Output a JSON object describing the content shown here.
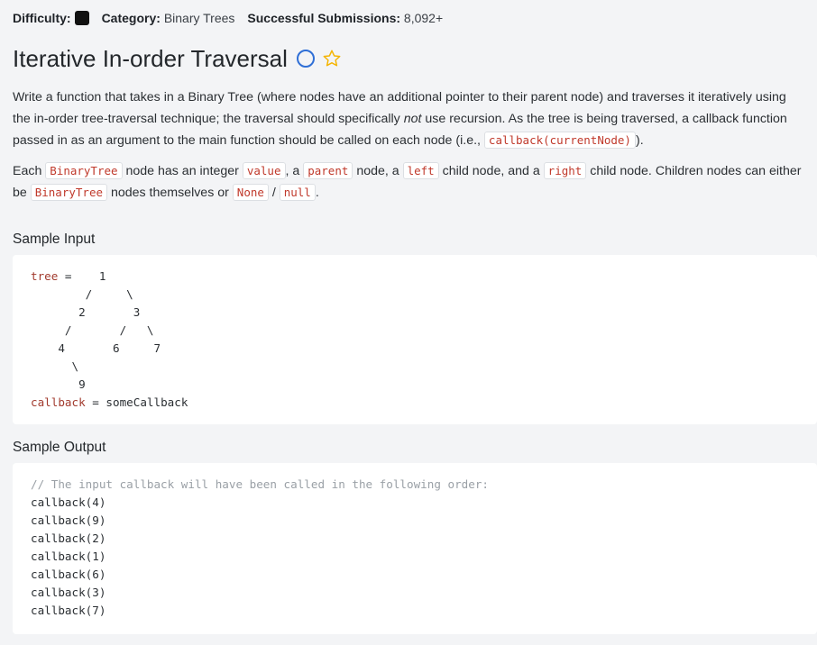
{
  "meta": {
    "difficulty_label": "Difficulty:",
    "category_label": "Category:",
    "category_value": "Binary Trees",
    "submissions_label": "Successful Submissions:",
    "submissions_value": "8,092+"
  },
  "title": "Iterative In-order Traversal",
  "description": {
    "p1_a": "Write a function that takes in a Binary Tree (where nodes have an additional pointer to their parent node) and traverses it iteratively using the in-order tree-traversal technique; the traversal should specifically ",
    "p1_em": "not",
    "p1_b": " use recursion. As the tree is being traversed, a callback function passed in as an argument to the main function should be called on each node (i.e., ",
    "p1_code": "callback(currentNode)",
    "p1_c": ").",
    "p2_each": "Each ",
    "p2_code1": "BinaryTree",
    "p2_t1": " node has an integer ",
    "p2_code2": "value",
    "p2_t2": ", a ",
    "p2_code3": "parent",
    "p2_t3": " node, a ",
    "p2_code4": "left",
    "p2_t4": " child node, and a ",
    "p2_code5": "right",
    "p2_t5": " child node. Children nodes can either be ",
    "p2_code6": "BinaryTree",
    "p2_t6": " nodes themselves or ",
    "p2_code7": "None",
    "p2_t7": " / ",
    "p2_code8": "null",
    "p2_t8": "."
  },
  "sample_input": {
    "label": "Sample Input",
    "tree_var": "tree",
    "tree_lines": [
      " =    1",
      "        /     \\",
      "       2       3",
      "     /       /   \\",
      "    4       6     7",
      "      \\",
      "       9"
    ],
    "callback_var": "callback",
    "callback_rest": " = someCallback"
  },
  "sample_output": {
    "label": "Sample Output",
    "comment": "// The input callback will have been called in the following order:",
    "lines": [
      "callback(4)",
      "callback(9)",
      "callback(2)",
      "callback(1)",
      "callback(6)",
      "callback(3)",
      "callback(7)"
    ]
  },
  "colors": {
    "accent": "#2f6fd6",
    "star": "#f4b400",
    "code_keyword": "#a23b2e",
    "code_comment": "#9aa0a6"
  },
  "icons": {
    "difficulty": "difficulty-square-icon",
    "status": "status-circle-icon",
    "favorite": "star-icon"
  }
}
